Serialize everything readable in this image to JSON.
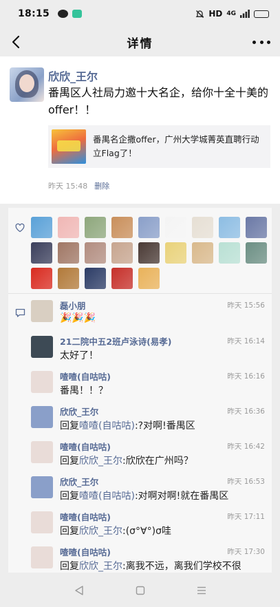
{
  "status": {
    "time": "18:15",
    "network": "HD",
    "signal": "4G"
  },
  "header": {
    "title": "详情"
  },
  "post": {
    "author": "欣欣_王尔",
    "text": "番禺区人社局力邀十大名企，给你十全十美的offer！！",
    "share_card": {
      "text": "番禺名企撒offer，广州大学城菁英直聘行动立Flag了！"
    },
    "time": "昨天 15:48",
    "delete_label": "删除"
  },
  "likes": {
    "avatars": [
      {
        "name": "totoro-avatar",
        "color": "#5aa1d8"
      },
      {
        "name": "girl-pink-avatar",
        "color": "#f0b7b5"
      },
      {
        "name": "field-avatar",
        "color": "#8ea77c"
      },
      {
        "name": "cat-face-avatar",
        "color": "#c98f5b"
      },
      {
        "name": "girl-avatar",
        "color": "#8a9fc9"
      },
      {
        "name": "sketch-avatar",
        "color": "#f4f4f4"
      },
      {
        "name": "white-cat-avatar",
        "color": "#e6dfd4"
      },
      {
        "name": "blue-scene-avatar",
        "color": "#8dbde3"
      },
      {
        "name": "person-blue-avatar",
        "color": "#6b79a6"
      },
      {
        "name": "night-avatar",
        "color": "#3b3f5c"
      },
      {
        "name": "warm-photo-avatar",
        "color": "#a07765"
      },
      {
        "name": "room-avatar",
        "color": "#b28d80"
      },
      {
        "name": "hair-avatar",
        "color": "#c7a58f"
      },
      {
        "name": "dark-portrait-avatar",
        "color": "#4a3a35"
      },
      {
        "name": "cartoon-avatar",
        "color": "#e9d27a"
      },
      {
        "name": "dog-avatar",
        "color": "#d9b98c"
      },
      {
        "name": "mint-avatar",
        "color": "#b9e0d4"
      },
      {
        "name": "forest-avatar",
        "color": "#6c8f84"
      },
      {
        "name": "flag-avatar",
        "color": "#d92b20"
      },
      {
        "name": "autumn-avatar",
        "color": "#b27a3a"
      },
      {
        "name": "dusk-avatar",
        "color": "#2c3c66"
      },
      {
        "name": "red-badge-avatar",
        "color": "#c6302a"
      },
      {
        "name": "doge-avatar",
        "color": "#e9b25a"
      }
    ]
  },
  "comments": [
    {
      "name": "磊小朋",
      "time": "昨天 15:56",
      "text": "🎉🎉🎉",
      "reply_to": "",
      "avatar_color": "#d9cfc2"
    },
    {
      "name": "21二院中五2班卢泳诗(易孝)",
      "time": "昨天 16:14",
      "text": "太好了！",
      "reply_to": "",
      "avatar_color": "#3d4a55"
    },
    {
      "name": "喳喳(自咕咕)",
      "time": "昨天 16:16",
      "text": "番禺！！？",
      "reply_to": "",
      "avatar_color": "#e9dcd8"
    },
    {
      "name": "欣欣_王尔",
      "time": "昨天 16:36",
      "prefix": "回复",
      "reply_to": "喳喳(自咕咕)",
      "text": ":?对啊!番禺区",
      "avatar_color": "#8a9fc9"
    },
    {
      "name": "喳喳(自咕咕)",
      "time": "昨天 16:42",
      "prefix": "回复",
      "reply_to": "欣欣_王尔",
      "text": ":欣欣在广州吗？",
      "avatar_color": "#e9dcd8"
    },
    {
      "name": "欣欣_王尔",
      "time": "昨天 16:53",
      "prefix": "回复",
      "reply_to": "喳喳(自咕咕)",
      "text": ":对啊对啊!就在番禺区",
      "avatar_color": "#8a9fc9"
    },
    {
      "name": "喳喳(自咕咕)",
      "time": "昨天 17:11",
      "prefix": "回复",
      "reply_to": "欣欣_王尔",
      "text": ":(σ°∀°)σ哇",
      "avatar_color": "#e9dcd8"
    },
    {
      "name": "喳喳(自咕咕)",
      "time": "昨天 17:30",
      "prefix": "回复",
      "reply_to": "欣欣_王尔",
      "text": ":离我不远，离我们学校不很",
      "avatar_color": "#e9dcd8"
    }
  ]
}
